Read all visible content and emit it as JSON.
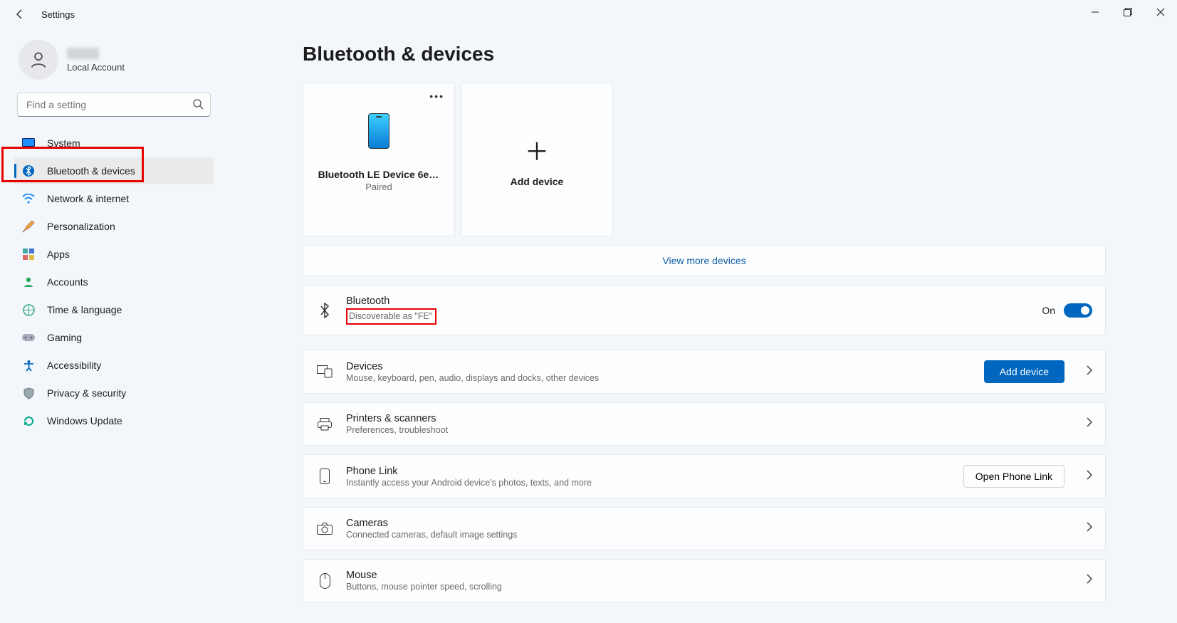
{
  "window": {
    "title": "Settings"
  },
  "user": {
    "account_type": "Local Account"
  },
  "search": {
    "placeholder": "Find a setting"
  },
  "sidebar": {
    "items": [
      {
        "label": "System"
      },
      {
        "label": "Bluetooth & devices",
        "active": true
      },
      {
        "label": "Network & internet"
      },
      {
        "label": "Personalization"
      },
      {
        "label": "Apps"
      },
      {
        "label": "Accounts"
      },
      {
        "label": "Time & language"
      },
      {
        "label": "Gaming"
      },
      {
        "label": "Accessibility"
      },
      {
        "label": "Privacy & security"
      },
      {
        "label": "Windows Update"
      }
    ]
  },
  "page": {
    "title": "Bluetooth & devices",
    "device_card": {
      "title": "Bluetooth LE Device 6ea...",
      "status": "Paired"
    },
    "add_card": {
      "label": "Add device"
    },
    "view_more": "View more devices",
    "bluetooth": {
      "title": "Bluetooth",
      "subtitle": "Discoverable as \"FE\"",
      "state": "On"
    },
    "rows": {
      "devices": {
        "title": "Devices",
        "sub": "Mouse, keyboard, pen, audio, displays and docks, other devices",
        "button": "Add device"
      },
      "printers": {
        "title": "Printers & scanners",
        "sub": "Preferences, troubleshoot"
      },
      "phonelink": {
        "title": "Phone Link",
        "sub": "Instantly access your Android device's photos, texts, and more",
        "button": "Open Phone Link"
      },
      "cameras": {
        "title": "Cameras",
        "sub": "Connected cameras, default image settings"
      },
      "mouse": {
        "title": "Mouse",
        "sub": "Buttons, mouse pointer speed, scrolling"
      }
    }
  }
}
